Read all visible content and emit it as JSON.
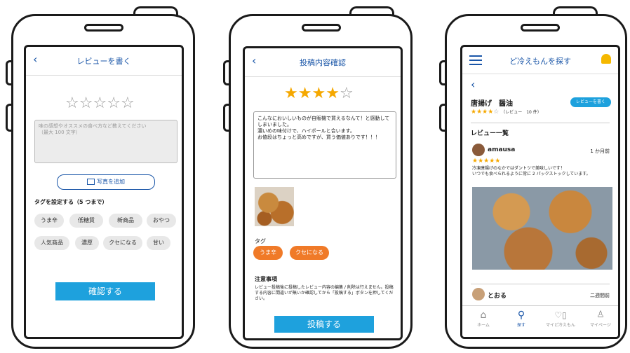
{
  "phone1": {
    "title": "レビューを書く",
    "review_placeholder": "味の感想やオススメの食べ方など教えてください\n（最大 100 文字）",
    "add_photo_label": "写真を追加",
    "tag_heading": "タグを設定する（5 つまで）",
    "tags": [
      "うま辛",
      "低糖質",
      "新商品",
      "おやつ",
      "人気商品",
      "濃厚",
      "クセになる",
      "甘い"
    ],
    "confirm_label": "確認する"
  },
  "phone2": {
    "title": "投稿内容確認",
    "rating": 4,
    "review_text": "こんなにおいしいものが自販機で買えるなんて！と感動してしまいました。\n濃いめの味付けで、ハイボールと合います。\nお値段はちょっと高めですが、買う価値ありです！！！",
    "tag_heading": "タグ",
    "selected_tags": [
      "うま辛",
      "クセになる"
    ],
    "notice_heading": "注意事項",
    "notice_text": "レビュー投稿後に投稿したレビュー内容の編集 / 削除は行えません。投稿する内容に間違いが無いか確認してから「投稿する」ボタンを押してください。",
    "post_label": "投稿する"
  },
  "phone3": {
    "title": "ど冷えもんを探す",
    "product_name": "唐揚げ　醤油",
    "rating": 4,
    "review_count_label": "（レビュー　10 件）",
    "write_review_label": "レビューを書く",
    "review_list_heading": "レビュー一覧",
    "reviews": [
      {
        "user": "amausa",
        "time": "1 か月前",
        "rating": 5,
        "text": "冷凍唐揚げのなかではダントツで美味しいです！\nいつでも食べられるように常に 2 パックストックしています。"
      },
      {
        "user": "とおる",
        "time": "二週間前"
      }
    ],
    "nav": [
      {
        "label": "ホーム",
        "icon": "home-icon"
      },
      {
        "label": "探す",
        "icon": "map-pin-icon"
      },
      {
        "label": "マイど冷えもん",
        "icon": "heart-machine-icon"
      },
      {
        "label": "マイページ",
        "icon": "user-icon"
      }
    ],
    "accent": "#1a56a8",
    "bell_color": "#f5b800"
  }
}
